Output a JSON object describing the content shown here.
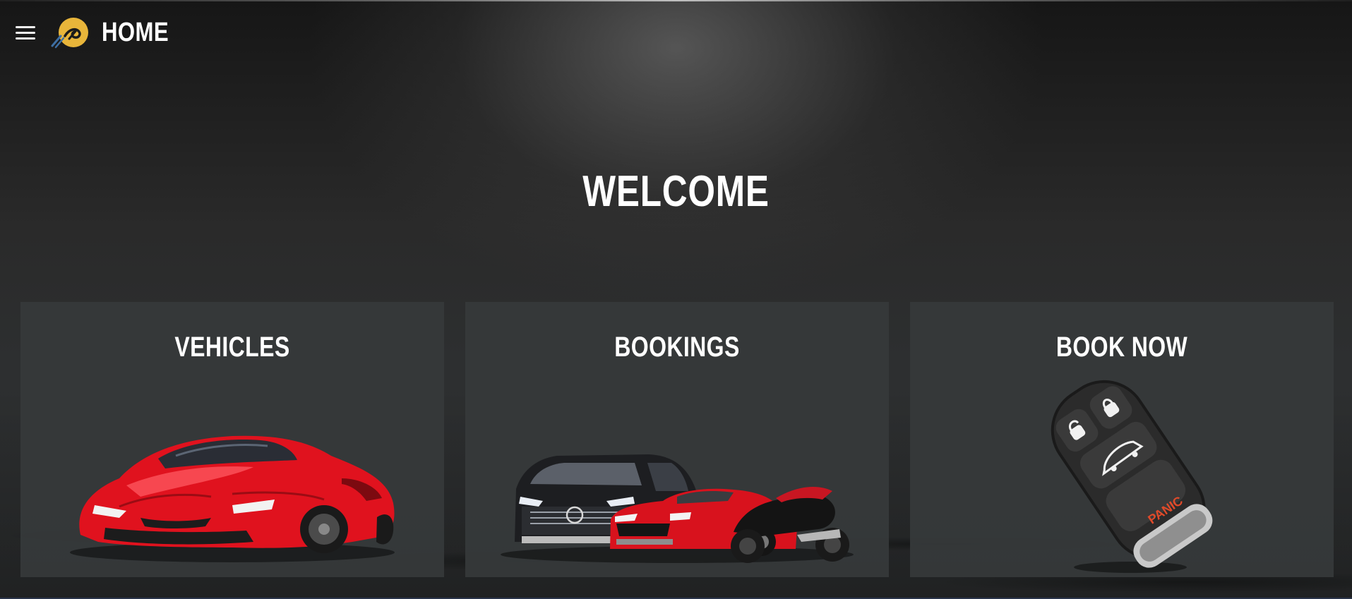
{
  "header": {
    "menu_icon": "hamburger-menu-icon",
    "logo_icon": "brand-logo-icon",
    "title": "HOME"
  },
  "hero": {
    "heading": "WELCOME"
  },
  "cards": [
    {
      "label": "VEHICLES",
      "icon": "red-sports-car-icon"
    },
    {
      "label": "BOOKINGS",
      "icon": "van-car-motorcycle-icon"
    },
    {
      "label": "BOOK NOW",
      "icon": "car-key-fob-icon",
      "key_button_text": "PANIC"
    }
  ],
  "colors": {
    "background": "#2a2a2a",
    "card": "#36393b",
    "text": "#ffffff",
    "logo_accent": "#e8b53a",
    "car_red": "#e0121e"
  }
}
